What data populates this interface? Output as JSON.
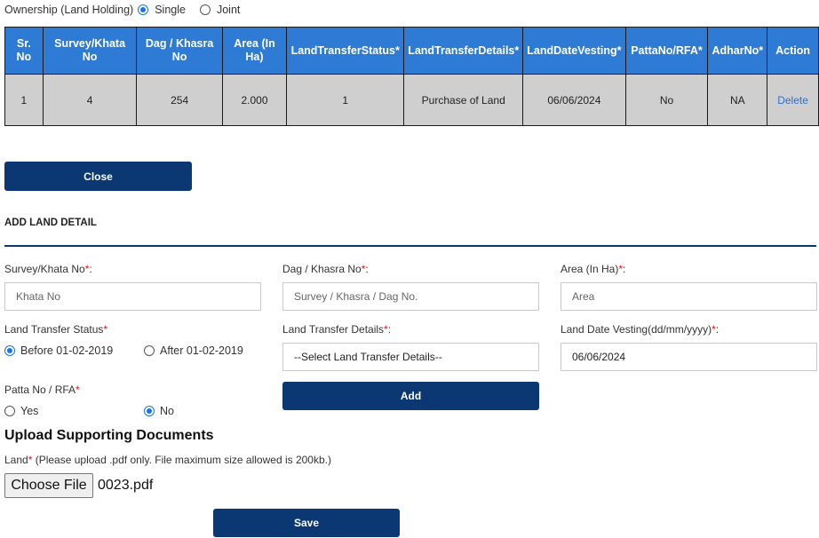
{
  "ownership": {
    "label": "Ownership (Land Holding)",
    "options": [
      {
        "label": "Single",
        "selected": true
      },
      {
        "label": "Joint",
        "selected": false
      }
    ]
  },
  "table": {
    "headers": [
      "Sr. No",
      "Survey/Khata No",
      "Dag / Khasra No",
      "Area (In Ha)",
      "LandTransferStatus*",
      "LandTransferDetails*",
      "LandDateVesting*",
      "PattaNo/RFA*",
      "AdharNo*",
      "Action"
    ],
    "rows": [
      {
        "sr_no": "1",
        "survey_khata": "4",
        "dag_khasra": "254",
        "area": "2.000",
        "transfer_status": "1",
        "transfer_details": "Purchase of Land",
        "date_vesting": "06/06/2024",
        "patta_rfa": "No",
        "adhar": "NA",
        "action": "Delete"
      }
    ]
  },
  "close_button": "Close",
  "add_section": {
    "title": "ADD LAND DETAIL",
    "survey": {
      "label": "Survey/Khata No",
      "req": "*",
      "suffix": ":",
      "placeholder": "Khata No"
    },
    "dag": {
      "label": "Dag / Khasra No",
      "req": "*",
      "suffix": ":",
      "placeholder": "Survey / Khasra / Dag No."
    },
    "area": {
      "label": "Area (In Ha)",
      "req": "*",
      "suffix": ":",
      "placeholder": "Area"
    },
    "transfer_status": {
      "label": "Land Transfer Status",
      "req": "*",
      "options": [
        {
          "label": "Before 01-02-2019",
          "selected": true
        },
        {
          "label": "After 01-02-2019",
          "selected": false
        }
      ]
    },
    "transfer_details": {
      "label": "Land Transfer Details",
      "req": "*",
      "suffix": ":",
      "value": "--Select Land Transfer Details--"
    },
    "date_vesting": {
      "label": "Land Date Vesting(dd/mm/yyyy)",
      "req": "*",
      "suffix": ":",
      "value": "06/06/2024"
    },
    "patta": {
      "label": "Patta No / RFA",
      "req": "*",
      "options": [
        {
          "label": "Yes",
          "selected": false
        },
        {
          "label": "No",
          "selected": true
        }
      ]
    },
    "add_button": "Add"
  },
  "upload": {
    "title": "Upload Supporting Documents",
    "note_label": "Land",
    "note_req": "*",
    "note_text": " (Please upload .pdf only. File maximum size allowed is 200kb.)",
    "choose_label": "Choose File",
    "file_name": "0023.pdf"
  },
  "save_button": "Save",
  "colors": {
    "table_header": "#2e7bd6",
    "table_row": "#cfcfcf",
    "button": "#0b3772",
    "divider": "#0b3a66",
    "required": "#dd1111",
    "radio_selected": "#1a73e8"
  }
}
